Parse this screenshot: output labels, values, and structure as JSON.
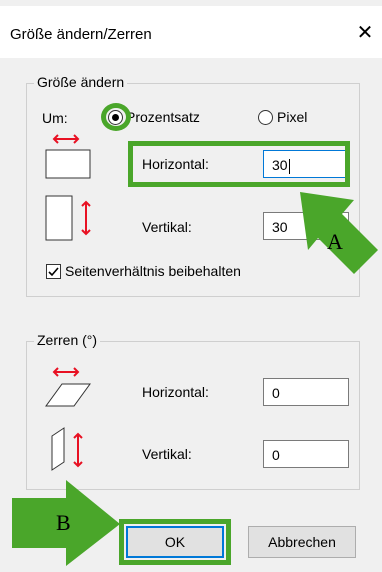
{
  "dialog": {
    "title": "Größe ändern/Zerren",
    "close_glyph": "✕"
  },
  "resize": {
    "legend": "Größe ändern",
    "by_label": "Um:",
    "percent_label": "Prozentsatz",
    "pixel_label": "Pixel",
    "selected_mode": "Prozentsatz",
    "horizontal_label": "Horizontal:",
    "horizontal_value": "30",
    "vertical_label": "Vertikal:",
    "vertical_value": "30",
    "keep_ratio_label": "Seitenverhältnis beibehalten",
    "keep_ratio_checked": true
  },
  "skew": {
    "legend": "Zerren (°)",
    "horizontal_label": "Horizontal:",
    "horizontal_value": "0",
    "vertical_label": "Vertikal:",
    "vertical_value": "0"
  },
  "buttons": {
    "ok_label": "OK",
    "cancel_label": "Abbrechen"
  },
  "annotations": {
    "arrow_a_label": "A",
    "arrow_b_label": "B",
    "highlight_color": "#4aa62a",
    "focus_color": "#0078d7",
    "red_arrow_color": "#e81123"
  }
}
